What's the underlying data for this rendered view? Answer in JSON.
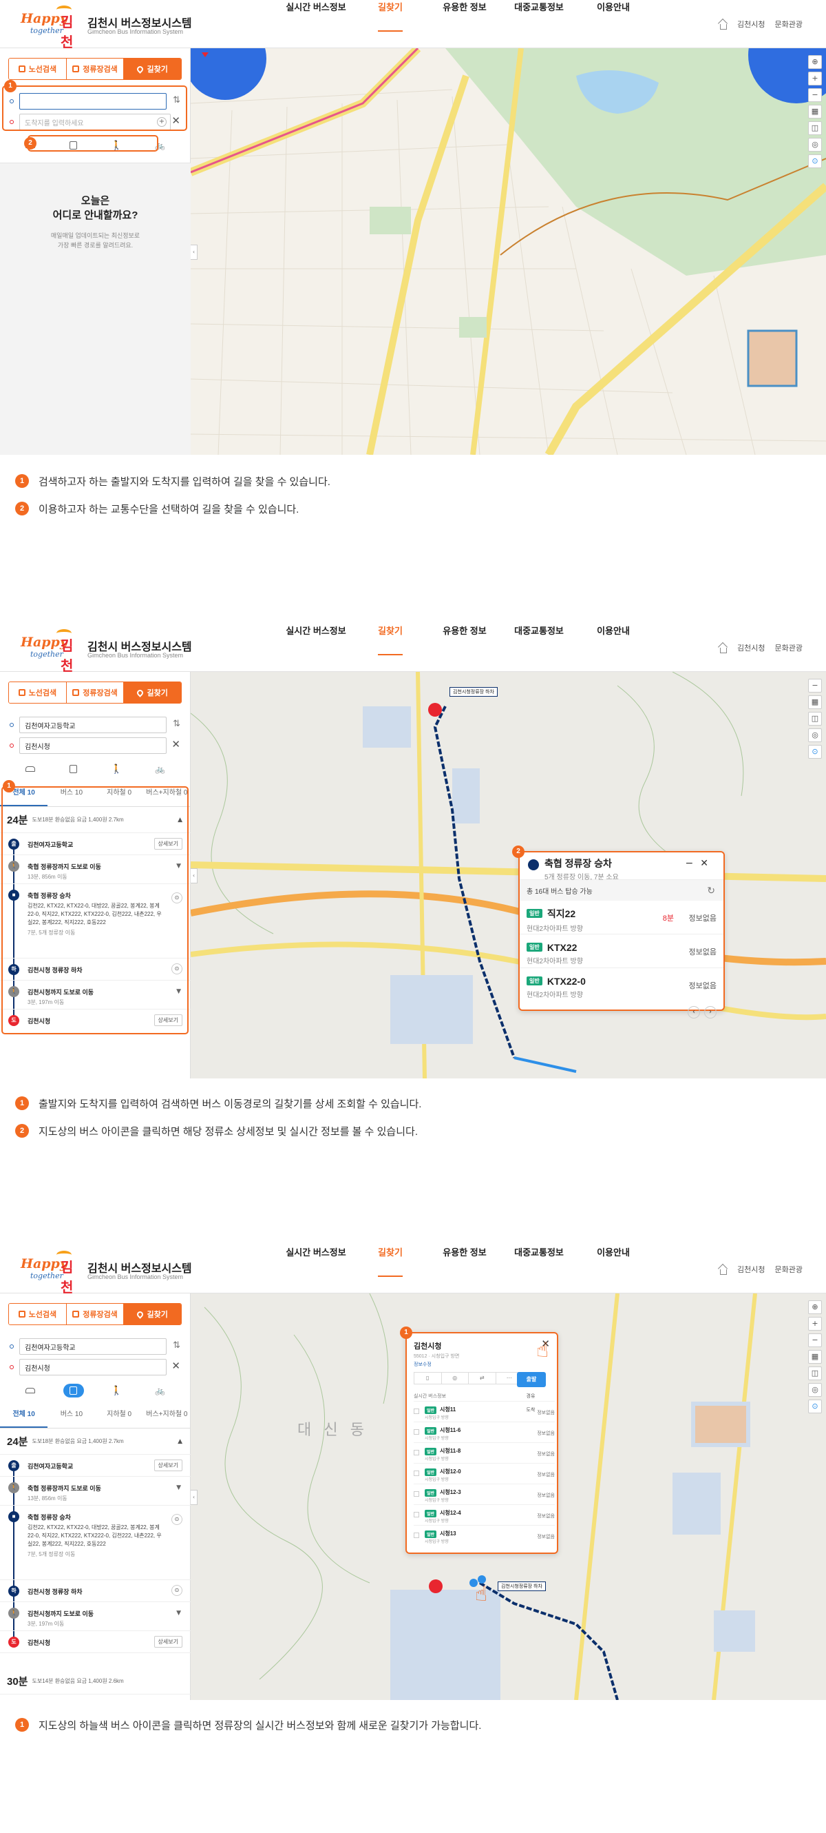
{
  "header": {
    "logo": {
      "happy": "Happy",
      "together": "together",
      "city": "김천"
    },
    "title": "김천시 버스정보시스템",
    "subtitle": "Gimcheon Bus Information System",
    "nav": [
      "실시간 버스정보",
      "길찾기",
      "유용한 정보",
      "대중교통정보",
      "이용안내"
    ],
    "active_nav": "길찾기",
    "util": [
      "김천시청",
      "문화관광"
    ]
  },
  "search_tabs": [
    "노선검색",
    "정류장검색",
    "길찾기"
  ],
  "colors": {
    "accent": "#f26a21",
    "navy": "#0b2f6b",
    "blue": "#2d8fe8",
    "green": "#1aa77a",
    "red": "#e8262f"
  },
  "section1": {
    "start_value": "",
    "end_placeholder": "도착지를 입력하세요",
    "welcome_title_1": "오늘은",
    "welcome_title_2": "어디로 안내할까요?",
    "welcome_desc_1": "매일매일 업데이트되는 최신정보로",
    "welcome_desc_2": "가장 빠른 경로를 알려드려요.",
    "notes": [
      {
        "n": "1",
        "text": "검색하고자 하는 출발지와 도착지를 입력하여 길을 찾을 수 있습니다."
      },
      {
        "n": "2",
        "text": "이용하고자 하는 교통수단을 선택하여 길을 찾을 수 있습니다."
      }
    ]
  },
  "route": {
    "start": "김천여자고등학교",
    "end": "김천시청",
    "result_tabs": [
      "전체 10",
      "버스 10",
      "지하철 0",
      "버스+지하철 0"
    ],
    "total_min": "24분",
    "summary": "도보18분   환승없음   요금 1,400원   2.7km",
    "car_link": "",
    "steps": {
      "s1": {
        "title": "김천여자고등학교",
        "btn": "상세보기"
      },
      "s2": {
        "title": "축협 정류장까지 도보로 이동",
        "sub": "13분, 856m 이동"
      },
      "s3": {
        "title": "축협 정류장 승차",
        "buses": "김천22, KTX22, KTX22-0, 대방22, 꿈골22, 봉계22, 봉계22-0, 직지22, KTX222, KTX222-0, 김천222, 내촌222, 우실22, 봉계222, 직지222, 호동222",
        "sub": "7분, 5개 정류장 이동"
      },
      "s4": {
        "title": "김천시청 정류장 하차"
      },
      "s5": {
        "title": "김천시청까지 도보로 이동",
        "sub": "3분, 197m 이동"
      },
      "s6": {
        "title": "김천시청",
        "btn": "상세보기"
      }
    },
    "next_min": "30분",
    "next_summary": "도보14분   환승없음   요금 1,400원   2.6km"
  },
  "section2": {
    "popup": {
      "title": "축협 정류장 승차",
      "sub": "5개 정류장 이동, 7분 소요",
      "total": "총 16대 버스 탑승 가능",
      "rows": [
        {
          "tag": "일반",
          "name": "직지22",
          "dir": "현대2차아파트 방향",
          "eta": "정보없음",
          "eta2": "8분"
        },
        {
          "tag": "일반",
          "name": "KTX22",
          "dir": "현대2차아파트 방향",
          "eta": "정보없음",
          "eta2": ""
        },
        {
          "tag": "일반",
          "name": "KTX22-0",
          "dir": "현대2차아파트 방향",
          "eta": "정보없음",
          "eta2": ""
        }
      ]
    },
    "map_label": "김천시청정류장 하차",
    "notes": [
      {
        "n": "1",
        "text": "출발지와 도착지를 입력하여 검색하면 버스 이동경로의 길찾기를 상세 조회할 수 있습니다."
      },
      {
        "n": "2",
        "text": "지도상의 버스 아이콘을 클릭하면 해당 정류소 상세정보 및 실시간 정보를 볼 수 있습니다."
      }
    ]
  },
  "section3": {
    "stop_popup": {
      "title": "김천시청",
      "sub1": "55012 · 시청입구 방면",
      "sub2": "정보수정",
      "go": "출발",
      "menu": [
        "경유",
        "도착"
      ],
      "list_head": "실시간 버스정보",
      "rows": [
        {
          "tag": "일반",
          "name": "시청11",
          "dir": "시청입구 방향",
          "eta": "정보없음"
        },
        {
          "tag": "일반",
          "name": "시청11-6",
          "dir": "시청입구 방향",
          "eta": "정보없음"
        },
        {
          "tag": "일반",
          "name": "시청11-8",
          "dir": "시청입구 방향",
          "eta": "정보없음"
        },
        {
          "tag": "일반",
          "name": "시청12-0",
          "dir": "시청입구 방향",
          "eta": "정보없음"
        },
        {
          "tag": "일반",
          "name": "시청12-3",
          "dir": "시청입구 방향",
          "eta": "정보없음"
        },
        {
          "tag": "일반",
          "name": "시청12-4",
          "dir": "시청입구 방향",
          "eta": "정보없음"
        },
        {
          "tag": "일반",
          "name": "시청13",
          "dir": "시청입구 방향",
          "eta": "정보없음"
        }
      ]
    },
    "map_label": "김천시청정류장 하차",
    "area_label": "대 신 동",
    "notes": [
      {
        "n": "1",
        "text": "지도상의 하늘색 버스 아이콘을 클릭하면 정류장의 실시간 버스정보와 함께 새로운 길찾기가 가능합니다."
      }
    ]
  },
  "map_tools": [
    "⊕",
    "+",
    "−",
    "▦",
    "◫",
    "◎",
    "⊙"
  ]
}
